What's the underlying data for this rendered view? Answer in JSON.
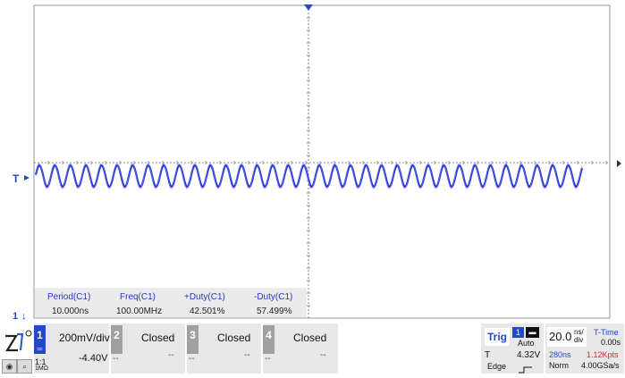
{
  "screen": {
    "trigger_marker": "T",
    "channel_marker": "1",
    "measurements": {
      "headers": [
        "Period(C1)",
        "Freq(C1)",
        "+Duty(C1)",
        "-Duty(C1)"
      ],
      "values": [
        "10.000ns",
        "100.00MHz",
        "42.501%",
        "57.499%"
      ]
    }
  },
  "channels": [
    {
      "num": "1",
      "scale": "200mV/div",
      "offset": "-4.40V",
      "coupling": "1:1",
      "impedance": "1MΩ"
    },
    {
      "num": "2",
      "status": "Closed",
      "left": "--",
      "right": "--"
    },
    {
      "num": "3",
      "status": "Closed",
      "left": "--",
      "right": "--"
    },
    {
      "num": "4",
      "status": "Closed",
      "left": "--",
      "right": "--"
    }
  ],
  "trigger": {
    "label": "Trig",
    "source": "1",
    "mode": "Auto",
    "type_label": "T",
    "level": "4.32V",
    "edge_label": "Edge"
  },
  "timebase": {
    "value": "20.0",
    "unit_top": "ns/",
    "unit_bottom": "div",
    "delay": "280ns",
    "sample_rate": "1.12Kpts",
    "mode": "Norm",
    "record": "4.00GSa/s"
  },
  "ttime": {
    "label": "T-Time",
    "value": "0.00s"
  },
  "colors": {
    "trace": "#2636d8",
    "accent": "#2448c8",
    "grid": "#cfcfcf",
    "meas_header": "#2a37c8",
    "trig_label": "#2448c8",
    "alert": "#d03030"
  }
}
